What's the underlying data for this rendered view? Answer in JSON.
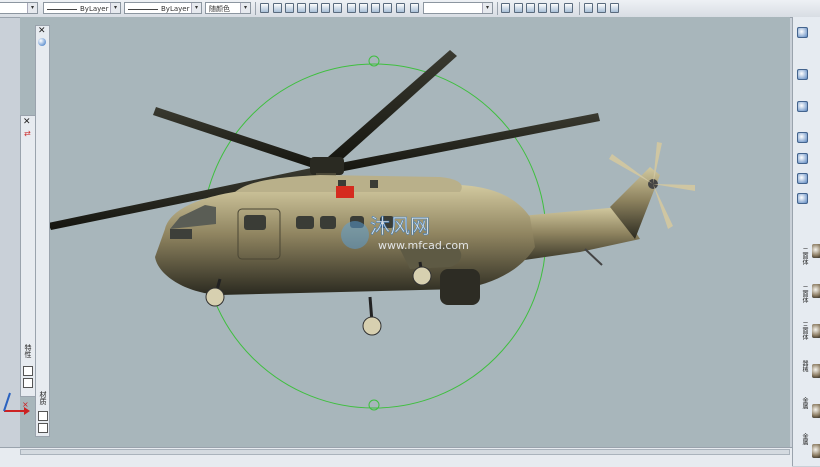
{
  "toolbar": {
    "linetype_value": "ByLayer",
    "lineweight_value": "ByLayer",
    "color_value": "随颜色"
  },
  "left_panels": {
    "properties_label": "特性",
    "materials_label": "材质"
  },
  "watermark": {
    "brand": "沐风网",
    "url": "www.mfcad.com"
  },
  "right_palette": {
    "labels": [
      "二面体",
      "二面体",
      "三面体",
      "器械",
      "金属",
      "金属"
    ]
  },
  "colors": {
    "viewport_bg": "#a8b6bb",
    "orbit_circle": "#3fbf3f",
    "helicopter_body": "#8f8460"
  }
}
